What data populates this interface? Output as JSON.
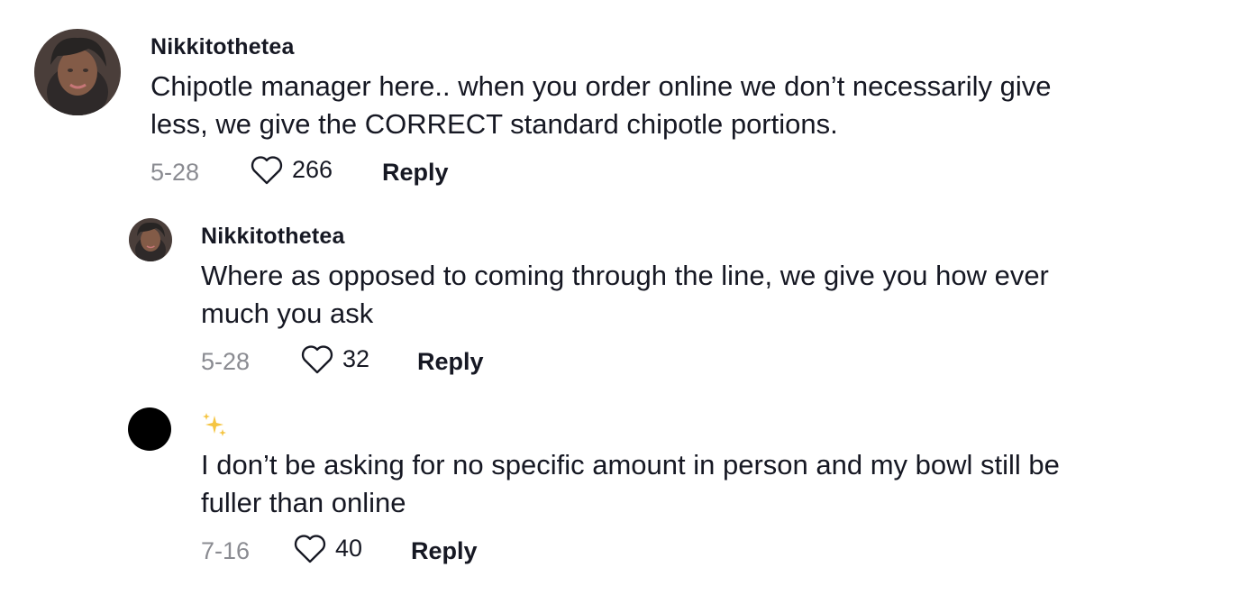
{
  "comments": [
    {
      "username": "Nikkitothetea",
      "text": "Chipotle manager here.. when you order online we don’t necessarily give\nless, we give the CORRECT standard chipotle portions.",
      "date": "5-28",
      "likes": "266",
      "reply_label": "Reply"
    },
    {
      "username": "Nikkitothetea",
      "text": "Where as opposed to coming through the line, we give you how ever\nmuch you ask",
      "date": "5-28",
      "likes": "32",
      "reply_label": "Reply"
    },
    {
      "username": "✨",
      "text": "I don’t be asking for no specific amount in person and my bowl still be\nfuller than online",
      "date": "7-16",
      "likes": "40",
      "reply_label": "Reply"
    }
  ],
  "icons": {
    "like": "heart-outline-icon",
    "avatar_default": "black-circle-avatar"
  },
  "colors": {
    "text": "#161823",
    "muted": "#8a8b91",
    "sparkle": "#f5c542"
  }
}
